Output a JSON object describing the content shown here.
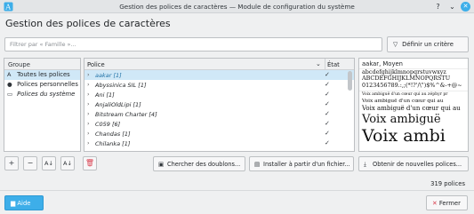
{
  "window": {
    "title": "Gestion des polices de caractères — Module de configuration du système",
    "heading": "Gestion des polices de caractères"
  },
  "filter": {
    "placeholder": "Filtrer par « Famille »...",
    "criteria_button": "Définir un critère"
  },
  "groups": {
    "header": "Groupe",
    "items": [
      {
        "label": "Toutes les polices",
        "icon": "letter-a-icon",
        "selected": true
      },
      {
        "label": "Polices personnelles",
        "icon": "user-icon",
        "selected": false
      },
      {
        "label": "Polices du système",
        "icon": "computer-icon",
        "selected": false
      }
    ]
  },
  "fonts": {
    "header_police": "Police",
    "header_etat": "État",
    "rows": [
      {
        "name": "aakar [1]",
        "enabled": true,
        "selected": true
      },
      {
        "name": "Abyssinica SIL [1]",
        "enabled": true,
        "selected": false
      },
      {
        "name": "Ani [1]",
        "enabled": true,
        "selected": false
      },
      {
        "name": "AnjaliOldLipi [1]",
        "enabled": true,
        "selected": false
      },
      {
        "name": "Bitstream Charter [4]",
        "enabled": true,
        "selected": false
      },
      {
        "name": "C059 [6]",
        "enabled": true,
        "selected": false
      },
      {
        "name": "Chandas [1]",
        "enabled": true,
        "selected": false
      },
      {
        "name": "Chilanka [1]",
        "enabled": true,
        "selected": false
      }
    ]
  },
  "preview": {
    "title": "aakar, Moyen",
    "lowercase": "abcdefghijklmnopqrstuvwxyz",
    "uppercase": "ABCDEFGHIJKLMNOPQRSTU",
    "digits": "0123456789.:,;(*!?'/\\\")$%^&-+@~",
    "sample": "Voix ambiguë d'un cœur qui au zéphyr pr",
    "sample_short": "Voix ambiguë d'un cœur qui au",
    "large_sample": "Voix ambiguë",
    "xlarge_sample": "Voix ambi"
  },
  "toolbar": {
    "add_icon": "plus-icon",
    "remove_icon": "minus-icon",
    "enable_icon": "font-enable-icon",
    "disable_icon": "font-disable-icon",
    "delete_icon": "trash-icon",
    "duplicates_button": "Chercher des doublons...",
    "install_button": "Installer à partir d'un fichier...",
    "get_new_button": "Obtenir de nouvelles polices..."
  },
  "status": {
    "count": "319 polices"
  },
  "footer": {
    "help_button": "Aide",
    "close_button": "Fermer"
  },
  "colors": {
    "accent": "#3daee9",
    "selection": "#d0e8f7",
    "danger": "#da4453"
  }
}
